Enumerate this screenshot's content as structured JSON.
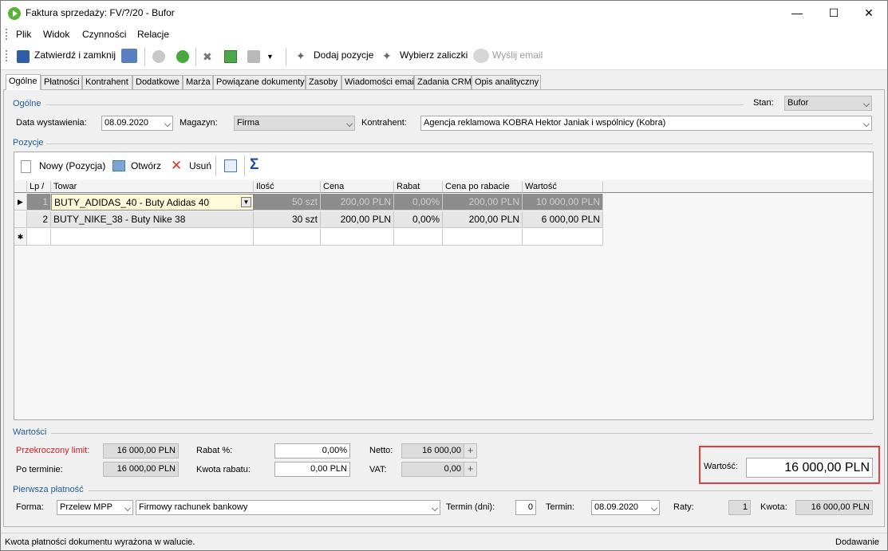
{
  "window": {
    "title": "Faktura sprzedaży: FV/?/20 - Bufor"
  },
  "menu": [
    "Plik",
    "Widok",
    "Czynności",
    "Relacje"
  ],
  "toolbar": {
    "confirm_close": "Zatwierdź i zamknij",
    "add_items": "Dodaj pozycje",
    "choose_advances": "Wybierz zaliczki",
    "send_email": "Wyślij email"
  },
  "tabs": [
    "Ogólne",
    "Płatności",
    "Kontrahent",
    "Dodatkowe",
    "Marża",
    "Powiązane dokumenty",
    "Zasoby",
    "Wiadomości email",
    "Zadania CRM",
    "Opis analityczny"
  ],
  "general": {
    "group_title": "Ogólne",
    "stan_label": "Stan:",
    "stan_value": "Bufor",
    "issue_date_label": "Data wystawienia:",
    "issue_date_value": "08.09.2020",
    "warehouse_label": "Magazyn:",
    "warehouse_value": "Firma",
    "contractor_label": "Kontrahent:",
    "contractor_value": "Agencja reklamowa KOBRA Hektor Janiak i wspólnicy  (Kobra)"
  },
  "positions": {
    "group_title": "Pozycje",
    "new_label": "Nowy (Pozycja)",
    "open_label": "Otwórz",
    "delete_label": "Usuń",
    "columns": [
      "Lp",
      "Towar",
      "Ilość",
      "Cena",
      "Rabat",
      "Cena po rabacie",
      "Wartość"
    ],
    "rows": [
      {
        "lp": "1",
        "towar": "BUTY_ADIDAS_40 - Buty Adidas 40",
        "ilosc": "50 szt",
        "cena": "200,00 PLN",
        "rabat": "0,00%",
        "cena_po": "200,00 PLN",
        "wartosc": "10 000,00 PLN"
      },
      {
        "lp": "2",
        "towar": "BUTY_NIKE_38 - Buty Nike 38",
        "ilosc": "30 szt",
        "cena": "200,00 PLN",
        "rabat": "0,00%",
        "cena_po": "200,00 PLN",
        "wartosc": "6 000,00 PLN"
      }
    ]
  },
  "values": {
    "group_title": "Wartości",
    "limit_label": "Przekroczony limit:",
    "limit_value": "16 000,00 PLN",
    "overdue_label": "Po terminie:",
    "overdue_value": "16 000,00 PLN",
    "discount_pct_label": "Rabat %:",
    "discount_pct_value": "0,00%",
    "discount_amt_label": "Kwota rabatu:",
    "discount_amt_value": "0,00 PLN",
    "net_label": "Netto:",
    "net_value": "16 000,00",
    "vat_label": "VAT:",
    "vat_value": "0,00",
    "total_label": "Wartość:",
    "total_value": "16 000,00 PLN"
  },
  "first_payment": {
    "group_title": "Pierwsza płatność",
    "form_label": "Forma:",
    "form_value": "Przelew MPP",
    "account_value": "Firmowy rachunek bankowy",
    "term_days_label": "Termin (dni):",
    "term_days_value": "0",
    "term_label": "Termin:",
    "term_value": "08.09.2020",
    "installments_label": "Raty:",
    "installments_value": "1",
    "amount_label": "Kwota:",
    "amount_value": "16 000,00 PLN"
  },
  "status": {
    "message": "Kwota płatności dokumentu wyrażona w walucie.",
    "mode": "Dodawanie"
  },
  "colors": {
    "accent_blue": "#1f5c99",
    "limit_red": "#d02020",
    "highlight": "#e04040"
  }
}
